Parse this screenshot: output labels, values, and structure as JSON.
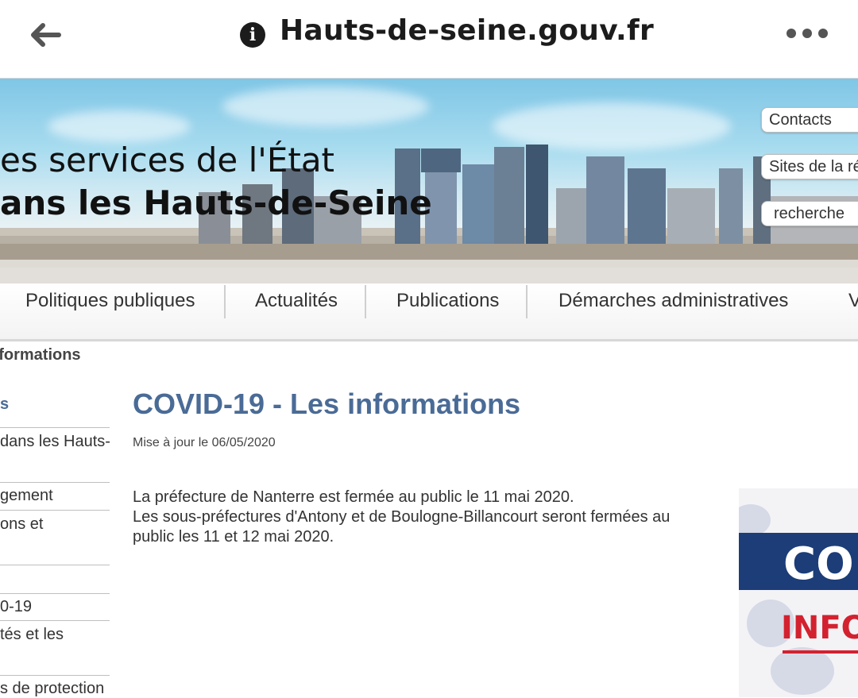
{
  "browser": {
    "url": "Hauts-de-seine.gouv.fr",
    "back_icon": "arrow-left-icon",
    "info_icon": "info-icon",
    "menu_icon": "more-dots-icon"
  },
  "banner": {
    "line1": "es services de l'État",
    "line2": "ans les Hauts-de-Seine",
    "buttons": [
      "Contacts",
      "Sites de la ré",
      "recherche"
    ]
  },
  "nav": {
    "items": [
      "Politiques publiques",
      "Actualités",
      "Publications",
      "Démarches administratives",
      "V"
    ]
  },
  "breadcrumb": "nformations",
  "sidebar": {
    "items": [
      "s",
      "dans les Hauts-",
      "gement",
      "ons et",
      "0-19",
      "tés et les",
      "s de protection"
    ]
  },
  "article": {
    "title": "COVID-19 - Les informations",
    "updated": "Mise à jour le 06/05/2020",
    "paragraph_lines": [
      "La préfecture de Nanterre est fermée au public le 11 mai 2020.",
      "Les sous-préfectures d'Antony et de Boulogne-Billancourt seront fermées au",
      "public les 11 et 12 mai 2020."
    ]
  },
  "covid_image": {
    "text1": "CO",
    "text2": "INFO"
  },
  "colors": {
    "title_blue": "#4a6b96",
    "covid_navy": "#1c3d78",
    "covid_red": "#d3212f"
  }
}
